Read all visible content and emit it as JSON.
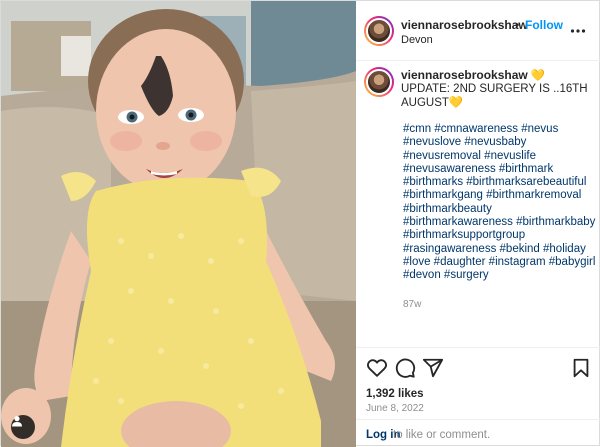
{
  "post": {
    "username": "viennarosebrookshaw",
    "follow_label": "Follow",
    "separator": "•",
    "location": "Devon",
    "caption": {
      "username": "viennarosebrookshaw",
      "emoji_start": "💛",
      "text": "UPDATE: 2ND SURGERY IS ..16TH AUGUST",
      "emoji_end": "💛"
    },
    "hashtags": "#cmn #cmnawareness #nevus #nevuslove #nevusbaby #nevusremoval #nevuslife #nevusawareness #birthmark #birthmarks #birthmarksarebeautiful #birthmarkgang #birthmarkremoval #birthmarkbeauty #birthmarkawareness #birthmarkbaby #birthmarksupportgroup #rasingawareness #bekind #holiday #love #daughter #instagram #babygirl #devon #surgery",
    "time_ago": "87w",
    "likes": "1,392 likes",
    "date": "June 8, 2022",
    "login_link": "Log in",
    "login_rest": "to like or comment."
  },
  "icons": {
    "more": "more-options-icon",
    "like": "heart-icon",
    "comment": "comment-icon",
    "share": "share-icon",
    "save": "bookmark-icon",
    "tag": "person-tag-icon"
  },
  "colors": {
    "accent": "#0095f6",
    "link": "#00376b",
    "muted": "#8e8e8e"
  }
}
